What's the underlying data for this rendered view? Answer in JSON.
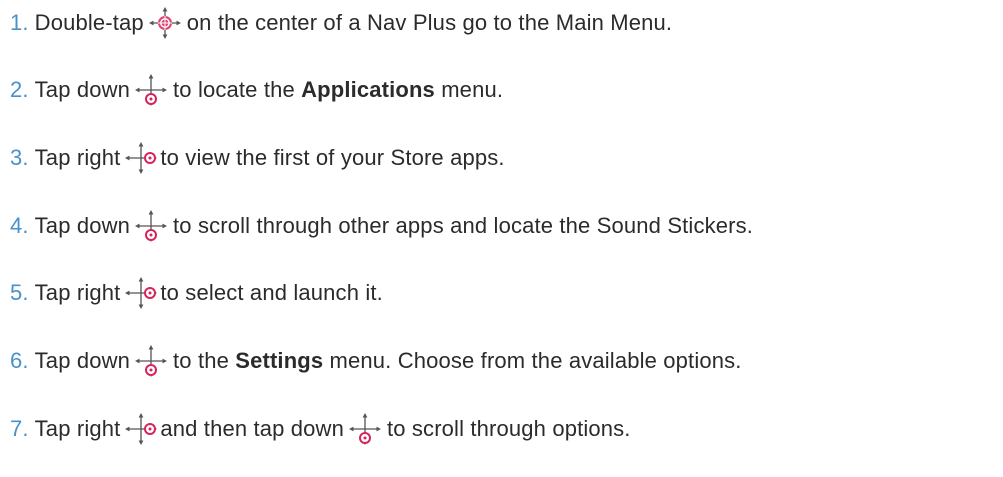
{
  "steps": [
    {
      "number": "1.",
      "text_a": "Double-tap",
      "icon": "nav-center-icon",
      "text_b": "on the center of a Nav Plus go to the Main Menu."
    },
    {
      "number": "2.",
      "text_a": "Tap down",
      "icon": "nav-down-icon",
      "text_b": "to locate the",
      "bold": "Applications",
      "text_c": "menu."
    },
    {
      "number": "3.",
      "text_a": "Tap right",
      "icon": "nav-right-icon",
      "text_b": "to view the first of your Store apps."
    },
    {
      "number": "4.",
      "text_a": "Tap down",
      "icon": "nav-down-icon",
      "text_b": "to scroll through other apps and locate the Sound Stickers."
    },
    {
      "number": "5.",
      "text_a": "Tap right",
      "icon": "nav-right-icon",
      "text_b": "to select and launch it."
    },
    {
      "number": "6.",
      "text_a": "Tap down",
      "icon": "nav-down-icon",
      "text_b": "to the",
      "bold": "Settings",
      "text_c": "menu. Choose from the available options."
    },
    {
      "number": "7.",
      "text_a": "Tap right",
      "icon": "nav-right-icon",
      "text_b": "and then tap down",
      "icon2": "nav-down-icon",
      "text_c": "to scroll through options."
    }
  ],
  "colors": {
    "number": "#4a90c9",
    "text": "#2b2b2b",
    "icon_accent": "#d6245a",
    "icon_arrows": "#555555"
  }
}
